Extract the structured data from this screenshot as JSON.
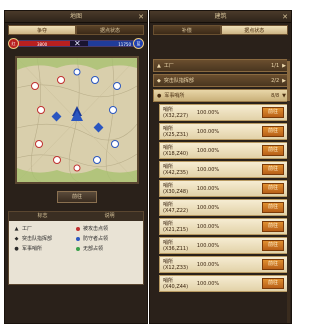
{
  "left_panel": {
    "title": "地图",
    "tabs": [
      "争夺",
      "据点状态"
    ],
    "score": {
      "red_value": "3800",
      "blue_value": "11750",
      "red_label": "红",
      "blue_label": "蓝"
    },
    "action_button": "前往",
    "legend": {
      "headers": [
        "标志",
        "说明"
      ],
      "items": [
        {
          "icon": "▲",
          "label": "工厂"
        },
        {
          "icon": "◆",
          "label": "突击队指挥部"
        },
        {
          "icon": "●",
          "label": "军事哨所"
        }
      ],
      "status_items": [
        {
          "label": "被攻击点领",
          "color": "#c03030"
        },
        {
          "label": "防守者占领",
          "color": "#2a56c0"
        },
        {
          "label": "无部占领",
          "color": "#3aa04a"
        }
      ]
    }
  },
  "right_panel": {
    "title": "建筑",
    "tabs": [
      "补偿",
      "据点状态"
    ],
    "categories": [
      {
        "label": "工厂",
        "count": "1/1",
        "icon": "▲",
        "open": false
      },
      {
        "label": "突击队指挥部",
        "count": "2/2",
        "icon": "◆",
        "open": false
      },
      {
        "label": "军事哨所",
        "count": "8/8",
        "icon": "●",
        "open": true
      }
    ],
    "rows": [
      {
        "name": "哨所(X32,Z27)",
        "pct": "100.00%",
        "btn": "前往"
      },
      {
        "name": "哨所(X25,Z31)",
        "pct": "100.00%",
        "btn": "前往"
      },
      {
        "name": "哨所(X18,Z40)",
        "pct": "100.00%",
        "btn": "前往"
      },
      {
        "name": "哨所(X42,Z35)",
        "pct": "100.00%",
        "btn": "前往"
      },
      {
        "name": "哨所(X30,Z48)",
        "pct": "100.00%",
        "btn": "前往"
      },
      {
        "name": "哨所(X47,Z22)",
        "pct": "100.00%",
        "btn": "前往"
      },
      {
        "name": "哨所(X21,Z15)",
        "pct": "100.00%",
        "btn": "前往"
      },
      {
        "name": "哨所(X36,Z11)",
        "pct": "100.00%",
        "btn": "前往"
      },
      {
        "name": "哨所(X12,Z33)",
        "pct": "100.00%",
        "btn": "前往"
      },
      {
        "name": "哨所(X40,Z44)",
        "pct": "100.00%",
        "btn": "前往"
      }
    ]
  },
  "colors": {
    "panel_bg": "#2a211a",
    "accent_orange": "#e09030",
    "red_team": "#b82020",
    "blue_team": "#203c9a"
  }
}
